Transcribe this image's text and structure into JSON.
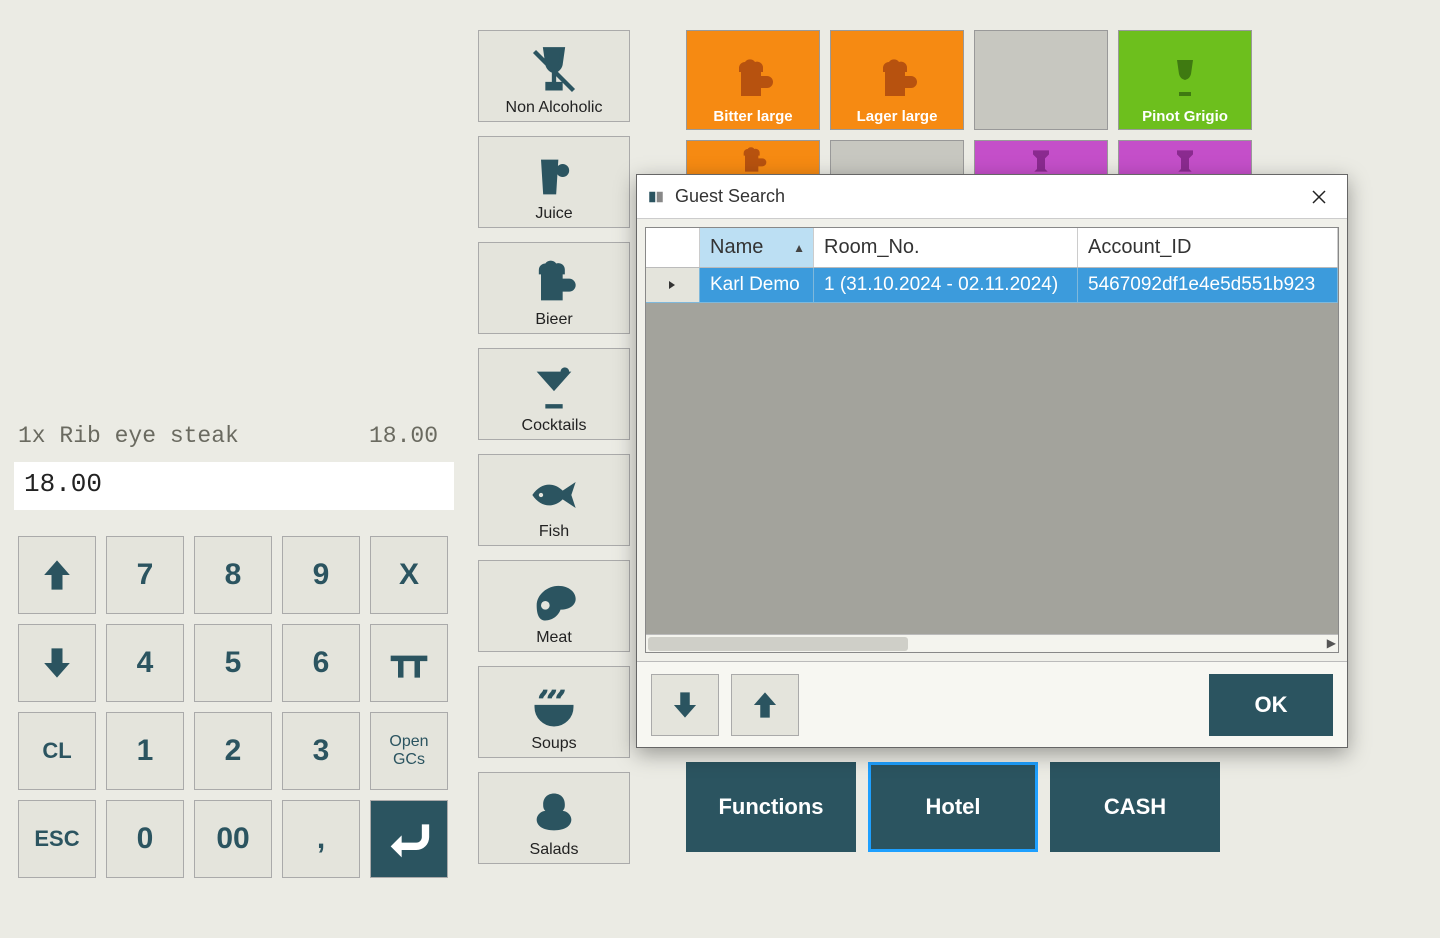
{
  "receipt": {
    "line": "1x  Rib eye steak",
    "price": "18.00",
    "total": "18.00"
  },
  "keypad": {
    "up": "↑",
    "k7": "7",
    "k8": "8",
    "k9": "9",
    "kx": "X",
    "down": "↓",
    "k4": "4",
    "k5": "5",
    "k6": "6",
    "table": "",
    "cl": "CL",
    "k1": "1",
    "k2": "2",
    "k3": "3",
    "open": "Open\nGCs",
    "esc": "ESC",
    "k0": "0",
    "k00": "00",
    "comma": ",",
    "enter": ""
  },
  "categories": [
    {
      "label": "Non Alcoholic",
      "icon": "nonalc"
    },
    {
      "label": "Juice",
      "icon": "juice"
    },
    {
      "label": "Bieer",
      "icon": "beer"
    },
    {
      "label": "Cocktails",
      "icon": "cocktail"
    },
    {
      "label": "Fish",
      "icon": "fish"
    },
    {
      "label": "Meat",
      "icon": "meat"
    },
    {
      "label": "Soups",
      "icon": "soup"
    },
    {
      "label": "Salads",
      "icon": "salad"
    }
  ],
  "products_row1": [
    {
      "label": "Bitter large",
      "class": "orange",
      "icon": "beer"
    },
    {
      "label": "Lager large",
      "class": "orange",
      "icon": "beer"
    },
    {
      "label": "",
      "class": "grey",
      "icon": ""
    },
    {
      "label": "Pinot Grigio",
      "class": "green",
      "icon": "wine"
    }
  ],
  "products_row2": [
    {
      "class": "orange",
      "icon": "beer"
    },
    {
      "class": "grey",
      "icon": ""
    },
    {
      "class": "purple",
      "icon": "glass"
    },
    {
      "class": "purple",
      "icon": "glass"
    }
  ],
  "actions": {
    "functions": "Functions",
    "hotel": "Hotel",
    "cash": "CASH"
  },
  "dialog": {
    "title": "Guest Search",
    "columns": {
      "name": "Name",
      "room": "Room_No.",
      "acct": "Account_ID"
    },
    "row": {
      "name": "Karl Demo",
      "room": "1 (31.10.2024 - 02.11.2024)",
      "acct": "5467092df1e4e5d551b923"
    },
    "ok": "OK"
  }
}
